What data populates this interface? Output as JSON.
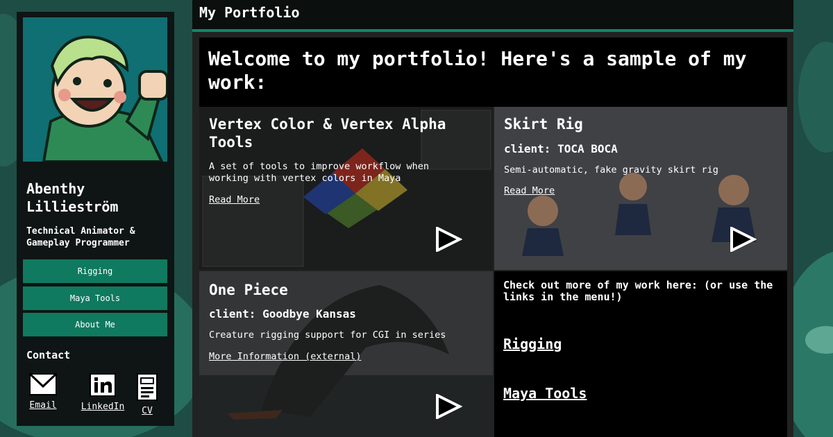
{
  "header": {
    "title": "My Portfolio"
  },
  "profile": {
    "name": "Abenthy Lillieström",
    "role": "Technical Animator & Gameplay Programmer"
  },
  "nav": {
    "items": [
      {
        "label": "Rigging"
      },
      {
        "label": "Maya Tools"
      },
      {
        "label": "About Me"
      }
    ]
  },
  "contact": {
    "title": "Contact",
    "items": [
      {
        "label": "Email",
        "icon": "envelope-icon"
      },
      {
        "label": "LinkedIn",
        "icon": "linkedin-icon"
      },
      {
        "label": "CV",
        "icon": "cv-document-icon"
      }
    ]
  },
  "main": {
    "welcome": "Welcome to my portfolio! Here's a sample of my work:",
    "cards": [
      {
        "title": "Vertex Color & Vertex Alpha Tools",
        "description": "A set of tools to improve workflow when working with vertex colors in Maya",
        "link": "Read More"
      },
      {
        "title": "Skirt Rig",
        "client": "client: TOCA BOCA",
        "description": "Semi-automatic, fake gravity skirt rig",
        "link": "Read More"
      },
      {
        "title": "One Piece",
        "client": "client: Goodbye Kansas",
        "description": "Creature rigging support for CGI in series",
        "link": "More Information (external)"
      }
    ],
    "more": {
      "text": "Check out more of my work here: (or use the links in the menu!)",
      "links": [
        {
          "label": "Rigging"
        },
        {
          "label": "Maya Tools"
        }
      ]
    }
  },
  "colors": {
    "accent": "#11876a",
    "nav_button": "#0f7a5f",
    "sidebar_bg": "#0e1514",
    "page_bg": "#1e4d45"
  }
}
